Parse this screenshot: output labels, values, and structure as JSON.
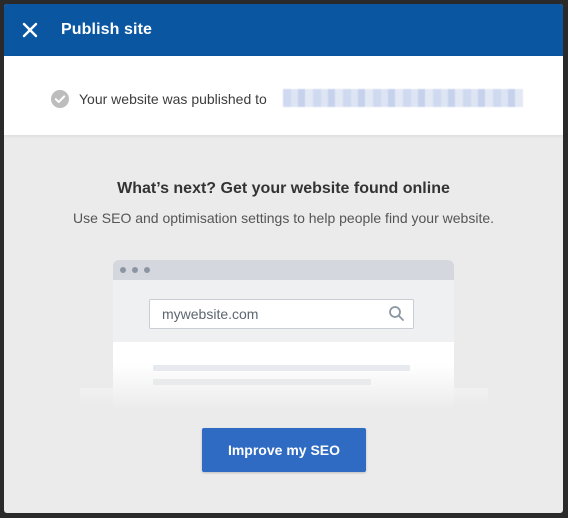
{
  "dialog": {
    "title": "Publish site"
  },
  "published": {
    "message": "Your website was published to"
  },
  "content": {
    "heading": "What’s next? Get your website found online",
    "subheading": "Use SEO and optimisation settings to help people find your website."
  },
  "mockup": {
    "search_value": "mywebsite.com"
  },
  "actions": {
    "improve_seo_label": "Improve my SEO"
  },
  "colors": {
    "titlebar": "#0a56a0",
    "button": "#2f6bc2",
    "background": "#ebebeb"
  },
  "icons": {
    "close": "close-icon",
    "success": "check-circle-icon",
    "search": "search-icon"
  }
}
